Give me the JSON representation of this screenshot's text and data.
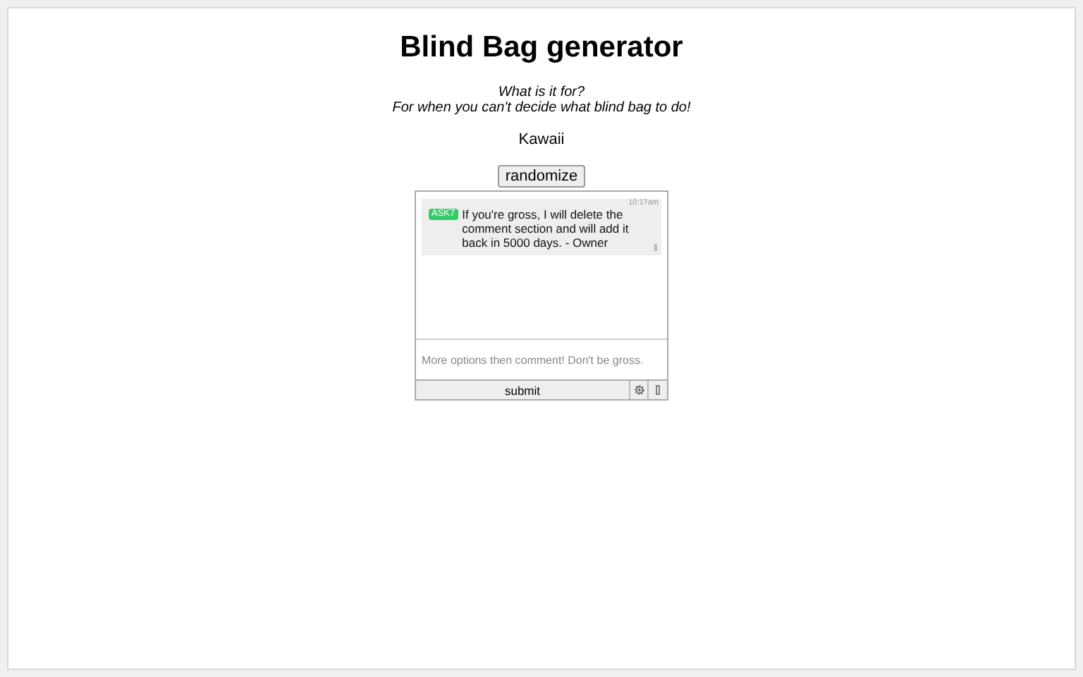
{
  "title": "Blind Bag generator",
  "intro": [
    "What is it for?",
    "For when you can't decide what blind bag to do!"
  ],
  "result": "Kawaii",
  "randomize_button": "randomize",
  "chat": {
    "messages": [
      {
        "user": "ASK7",
        "color": "#33cc66",
        "time": "10:17am",
        "text": "If you're gross, I will delete the comment section and will add it back in 5000 days. - Owner"
      }
    ],
    "input": {
      "placeholder": "More options then comment! Don't be gross."
    },
    "submit_button": "submit"
  }
}
